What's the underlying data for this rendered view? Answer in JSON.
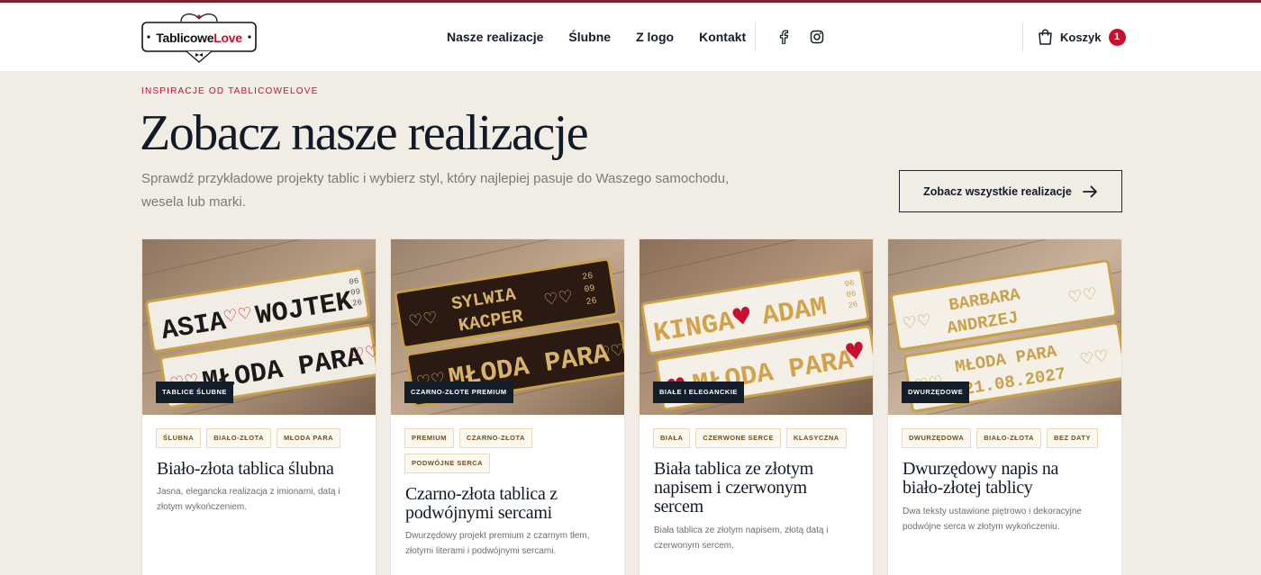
{
  "header": {
    "logo": {
      "part1": "Tablicowe",
      "part2": "Love"
    },
    "nav": [
      {
        "label": "Nasze realizacje"
      },
      {
        "label": "Ślubne"
      },
      {
        "label": "Z logo"
      },
      {
        "label": "Kontakt"
      }
    ],
    "social": [
      "facebook-icon",
      "instagram-icon"
    ],
    "cart": {
      "label": "Koszyk",
      "count": "1",
      "icon": "shopping-bag-icon"
    }
  },
  "hero": {
    "eyebrow": "INSPIRACJE OD TABLICOWELOVE",
    "title": "Zobacz nasze realizacje",
    "lead": "Sprawdź przykładowe projekty tablic i wybierz styl, który najlepiej pasuje do Waszego samochodu, wesela lub marki.",
    "button": "Zobacz wszystkie realizacje"
  },
  "colors": {
    "accent": "#c8102e",
    "dark": "#141d2a",
    "background": "#f1ece4",
    "gold": "#c9a14a"
  },
  "cards": [
    {
      "category": "TABLICE ŚLUBNE",
      "tags": [
        "ŚLUBNA",
        "BIAŁO-ZŁOTA",
        "MŁODA PARA"
      ],
      "title": "Biało-złota tablica ślubna",
      "desc": "Jasna, elegancka realizacja z imionami, datą i złotym wykończeniem.",
      "plate": {
        "line1a": "ASIA",
        "line1b": "WOJTEK",
        "line2": "MŁODA PARA",
        "date": [
          "06",
          "09",
          "26"
        ]
      }
    },
    {
      "category": "CZARNO-ZŁOTE PREMIUM",
      "tags": [
        "PREMIUM",
        "CZARNO-ZŁOTA",
        "PODWÓJNE SERCA"
      ],
      "title": "Czarno-złota tablica z podwójnymi sercami",
      "desc": "Dwurzędowy projekt premium z czarnym tłem, złotymi literami i podwójnymi sercami.",
      "plate": {
        "line1a": "SYLWIA",
        "line1b": "KACPER",
        "line2": "MŁODA PARA",
        "date": [
          "26",
          "09",
          "26"
        ]
      }
    },
    {
      "category": "BIAŁE I ELEGANCKIE",
      "tags": [
        "BIAŁA",
        "CZERWONE SERCE",
        "KLASYCZNA"
      ],
      "title": "Biała tablica ze złotym napisem i czerwonym sercem",
      "desc": "Biała tablica ze złotym napisem, złotą datą i czerwonym sercem.",
      "plate": {
        "line1a": "KINGA",
        "line1b": "ADAM",
        "line2": "MŁODA PARA",
        "date": [
          "06",
          "06",
          "26"
        ]
      }
    },
    {
      "category": "DWURZĘDOWE",
      "tags": [
        "DWURZĘDOWA",
        "BIAŁO-ZŁOTA",
        "BEZ DATY"
      ],
      "title": "Dwurzędowy napis na biało-złotej tablicy",
      "desc": "Dwa teksty ustawione piętrowo i dekoracyjne podwójne serca w złotym wykończeniu.",
      "plate": {
        "line1a": "BARBARA",
        "line1b": "ANDRZEJ",
        "line2": "MŁODA PARA",
        "line2b": "21.08.2027"
      }
    }
  ]
}
